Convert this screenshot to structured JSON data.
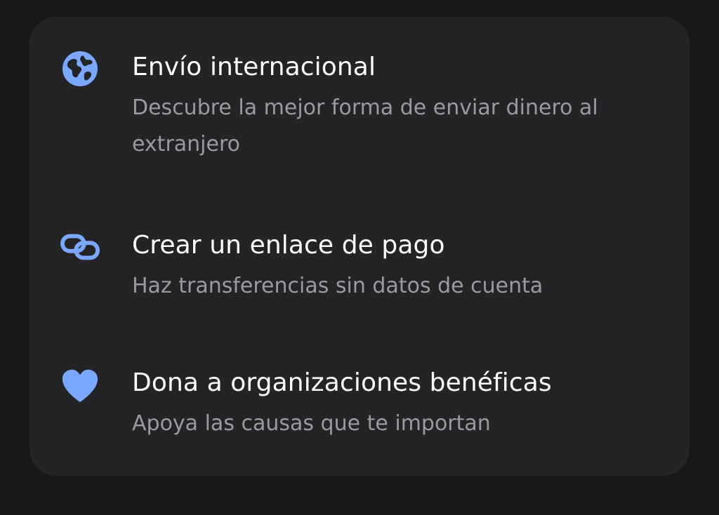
{
  "colors": {
    "background": "#18181a",
    "card": "#242427",
    "accent": "#7aa7ff",
    "title": "#ffffff",
    "subtitle": "#9a9a9f"
  },
  "options": [
    {
      "icon": "globe-icon",
      "title": "Envío internacional",
      "subtitle": "Descubre la mejor forma de enviar dinero al extranjero"
    },
    {
      "icon": "link-icon",
      "title": "Crear un enlace de pago",
      "subtitle": "Haz transferencias sin datos de cuenta"
    },
    {
      "icon": "heart-icon",
      "title": "Dona a organizaciones benéficas",
      "subtitle": "Apoya las causas que te importan"
    }
  ]
}
